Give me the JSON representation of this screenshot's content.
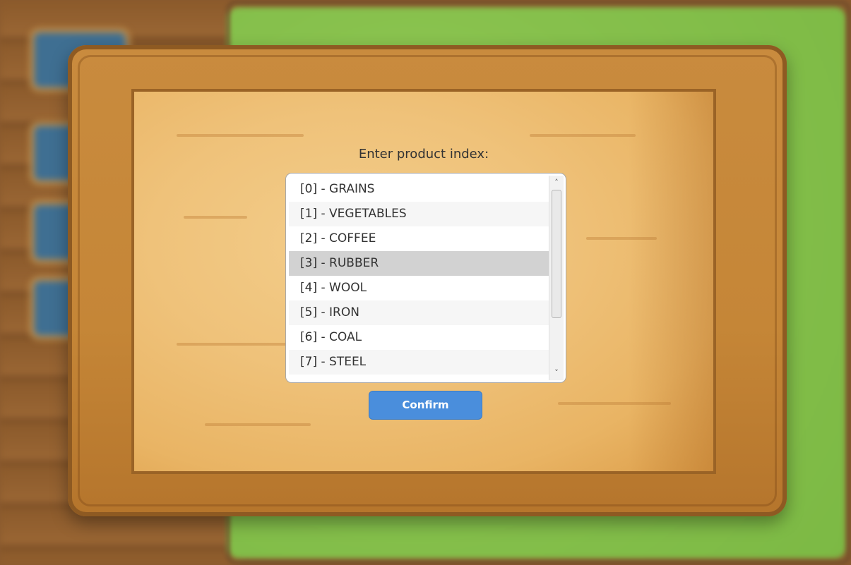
{
  "dialog": {
    "prompt": "Enter product index:",
    "items": [
      {
        "label": "[0] - GRAINS",
        "selected": false
      },
      {
        "label": "[1] - VEGETABLES",
        "selected": false
      },
      {
        "label": "[2] - COFFEE",
        "selected": false
      },
      {
        "label": "[3] - RUBBER",
        "selected": true
      },
      {
        "label": "[4] - WOOL",
        "selected": false
      },
      {
        "label": "[5] - IRON",
        "selected": false
      },
      {
        "label": "[6] - COAL",
        "selected": false
      },
      {
        "label": "[7] - STEEL",
        "selected": false
      }
    ],
    "confirm_label": "Confirm"
  },
  "icons": {
    "scroll_up": "chevron-up-icon",
    "scroll_down": "chevron-down-icon"
  },
  "colors": {
    "accent": "#4a8edc",
    "selected_row": "#d2d2d2",
    "parchment": "#efc27a",
    "frame_wood": "#c98b3e",
    "grass": "#86c04c"
  }
}
